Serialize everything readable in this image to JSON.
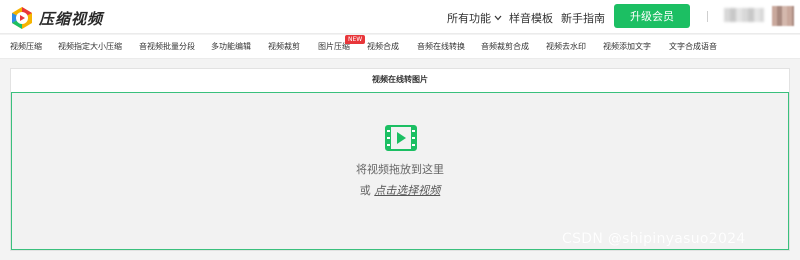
{
  "header": {
    "logo_text": "压缩视频",
    "nav": {
      "features": "所有功能",
      "samples": "样音模板",
      "guide": "新手指南"
    },
    "upgrade_button": "升级会员",
    "accent_color": "#1cbf63"
  },
  "tools": {
    "items": [
      "视频压缩",
      "视频指定大小压缩",
      "音视频批量分段",
      "多功能编辑",
      "视频裁剪",
      "图片压缩",
      "视频合成",
      "音频在线转换",
      "音频裁剪合成",
      "视频去水印",
      "视频添加文字",
      "文字合成语音"
    ],
    "new_badge": "NEW"
  },
  "panel": {
    "title": "视频在线转图片",
    "drop_hint": "将视频拖放到这里",
    "or_text": "或",
    "select_link": "点击选择视频"
  },
  "icons": {
    "logo": "play-logo-icon",
    "features_dropdown": "chevron-down-icon",
    "upload": "video-file-icon"
  },
  "watermark": "CSDN @shipinyasuo2024"
}
